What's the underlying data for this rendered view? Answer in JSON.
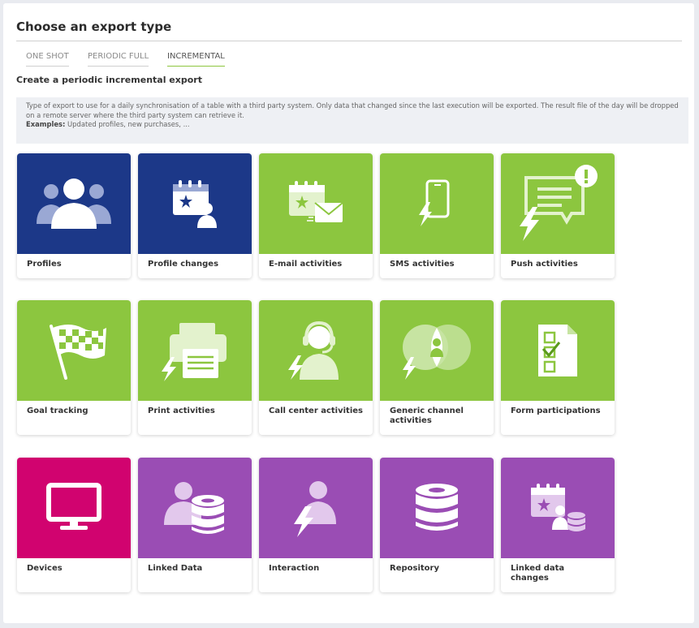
{
  "page": {
    "title": "Choose an export type",
    "tabs": [
      {
        "label": "ONE SHOT",
        "active": false
      },
      {
        "label": "PERIODIC FULL",
        "active": false
      },
      {
        "label": "INCREMENTAL",
        "active": true
      }
    ],
    "subtitle": "Create a periodic incremental export",
    "description": "Type of export to use for a daily synchronisation of a table with a third party system. Only data that changed since the last execution will be exported. The result file of the day will be dropped on a remote server where the third party system can retrieve it.",
    "examples_label": "Examples:",
    "examples_text": " Updated profiles, new purchases, ..."
  },
  "colors": {
    "blue": "#1c3888",
    "green": "#8cc63f",
    "pink": "#d1036f",
    "purple": "#9a4db4",
    "active_tab": "#8dc63f"
  },
  "cards": [
    {
      "label": "Profiles",
      "icon": "people-icon"
    },
    {
      "label": "Profile changes",
      "icon": "calendar-user-icon"
    },
    {
      "label": "E-mail activities",
      "icon": "calendar-mail-icon"
    },
    {
      "label": "SMS activities",
      "icon": "phone-bolt-icon"
    },
    {
      "label": "Push activities",
      "icon": "chat-alert-icon"
    },
    {
      "label": "Goal tracking",
      "icon": "checkered-flag-icon"
    },
    {
      "label": "Print activities",
      "icon": "printer-icon"
    },
    {
      "label": "Call center activities",
      "icon": "headset-agent-icon"
    },
    {
      "label": "Generic channel activities",
      "icon": "venn-channel-icon"
    },
    {
      "label": "Form participations",
      "icon": "checklist-form-icon"
    },
    {
      "label": "Devices",
      "icon": "monitor-icon"
    },
    {
      "label": "Linked Data",
      "icon": "user-database-icon"
    },
    {
      "label": "Interaction",
      "icon": "user-bolt-icon"
    },
    {
      "label": "Repository",
      "icon": "database-icon"
    },
    {
      "label": "Linked data changes",
      "icon": "calendar-user-database-icon"
    }
  ]
}
